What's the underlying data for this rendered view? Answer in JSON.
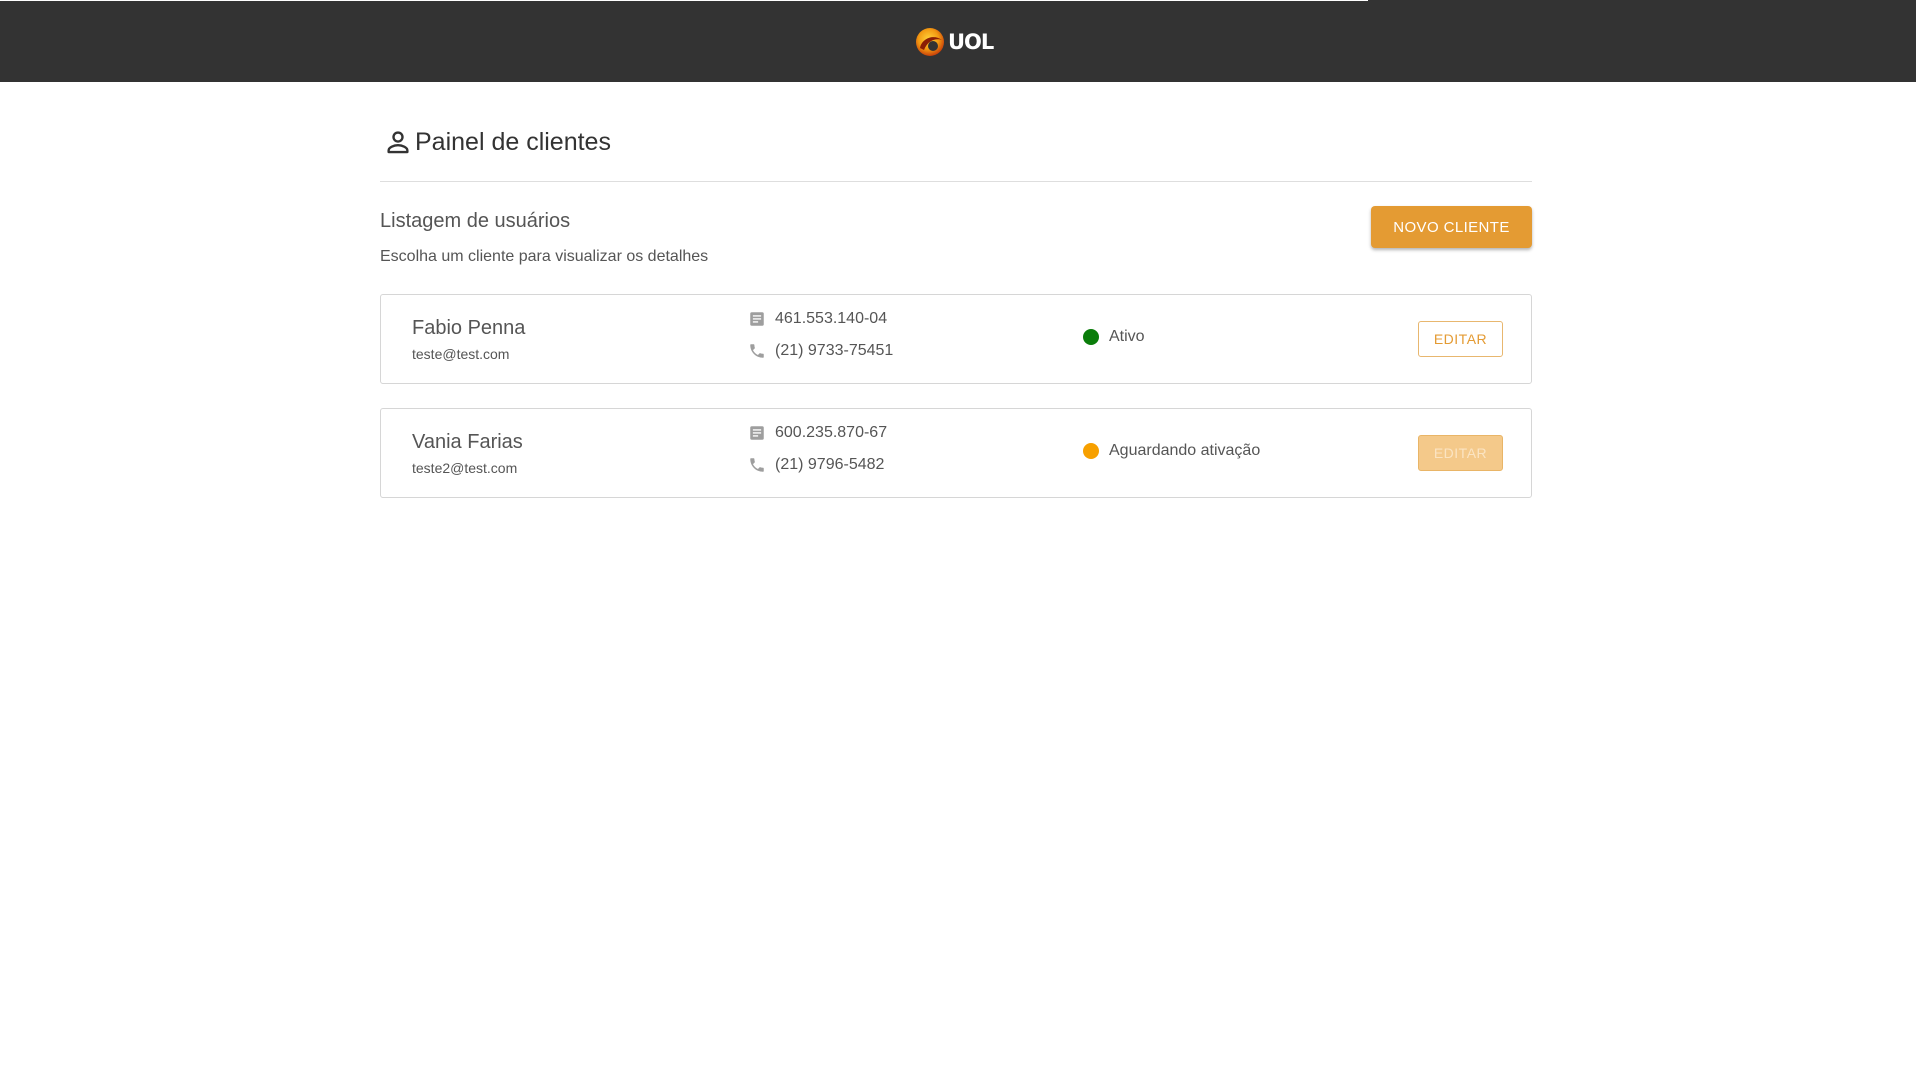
{
  "header": {
    "logo_text": "UOL",
    "logo_icon": "uol-logo-icon"
  },
  "page": {
    "title": "Painel de clientes",
    "title_icon": "person-icon",
    "list_heading": "Listagem de usuários",
    "list_subheading": "Escolha um cliente para visualizar os detalhes",
    "new_client_label": "NOVO CLIENTE"
  },
  "colors": {
    "header_bg": "#333333",
    "accent": "#e49b33",
    "status_active": "#0a7d0a",
    "status_pending": "#f7a000"
  },
  "clients": [
    {
      "name": "Fabio Penna",
      "email": "teste@test.com",
      "document": "461.553.140-04",
      "document_icon": "document-icon",
      "phone": "(21) 9733-75451",
      "phone_icon": "phone-icon",
      "status": "Ativo",
      "status_color": "#0a7d0a",
      "edit_label": "EDITAR",
      "edit_enabled": true
    },
    {
      "name": "Vania Farias",
      "email": "teste2@test.com",
      "document": "600.235.870-67",
      "document_icon": "document-icon",
      "phone": "(21) 9796-5482",
      "phone_icon": "phone-icon",
      "status": "Aguardando ativação",
      "status_color": "#f7a000",
      "edit_label": "EDITAR",
      "edit_enabled": false
    }
  ]
}
